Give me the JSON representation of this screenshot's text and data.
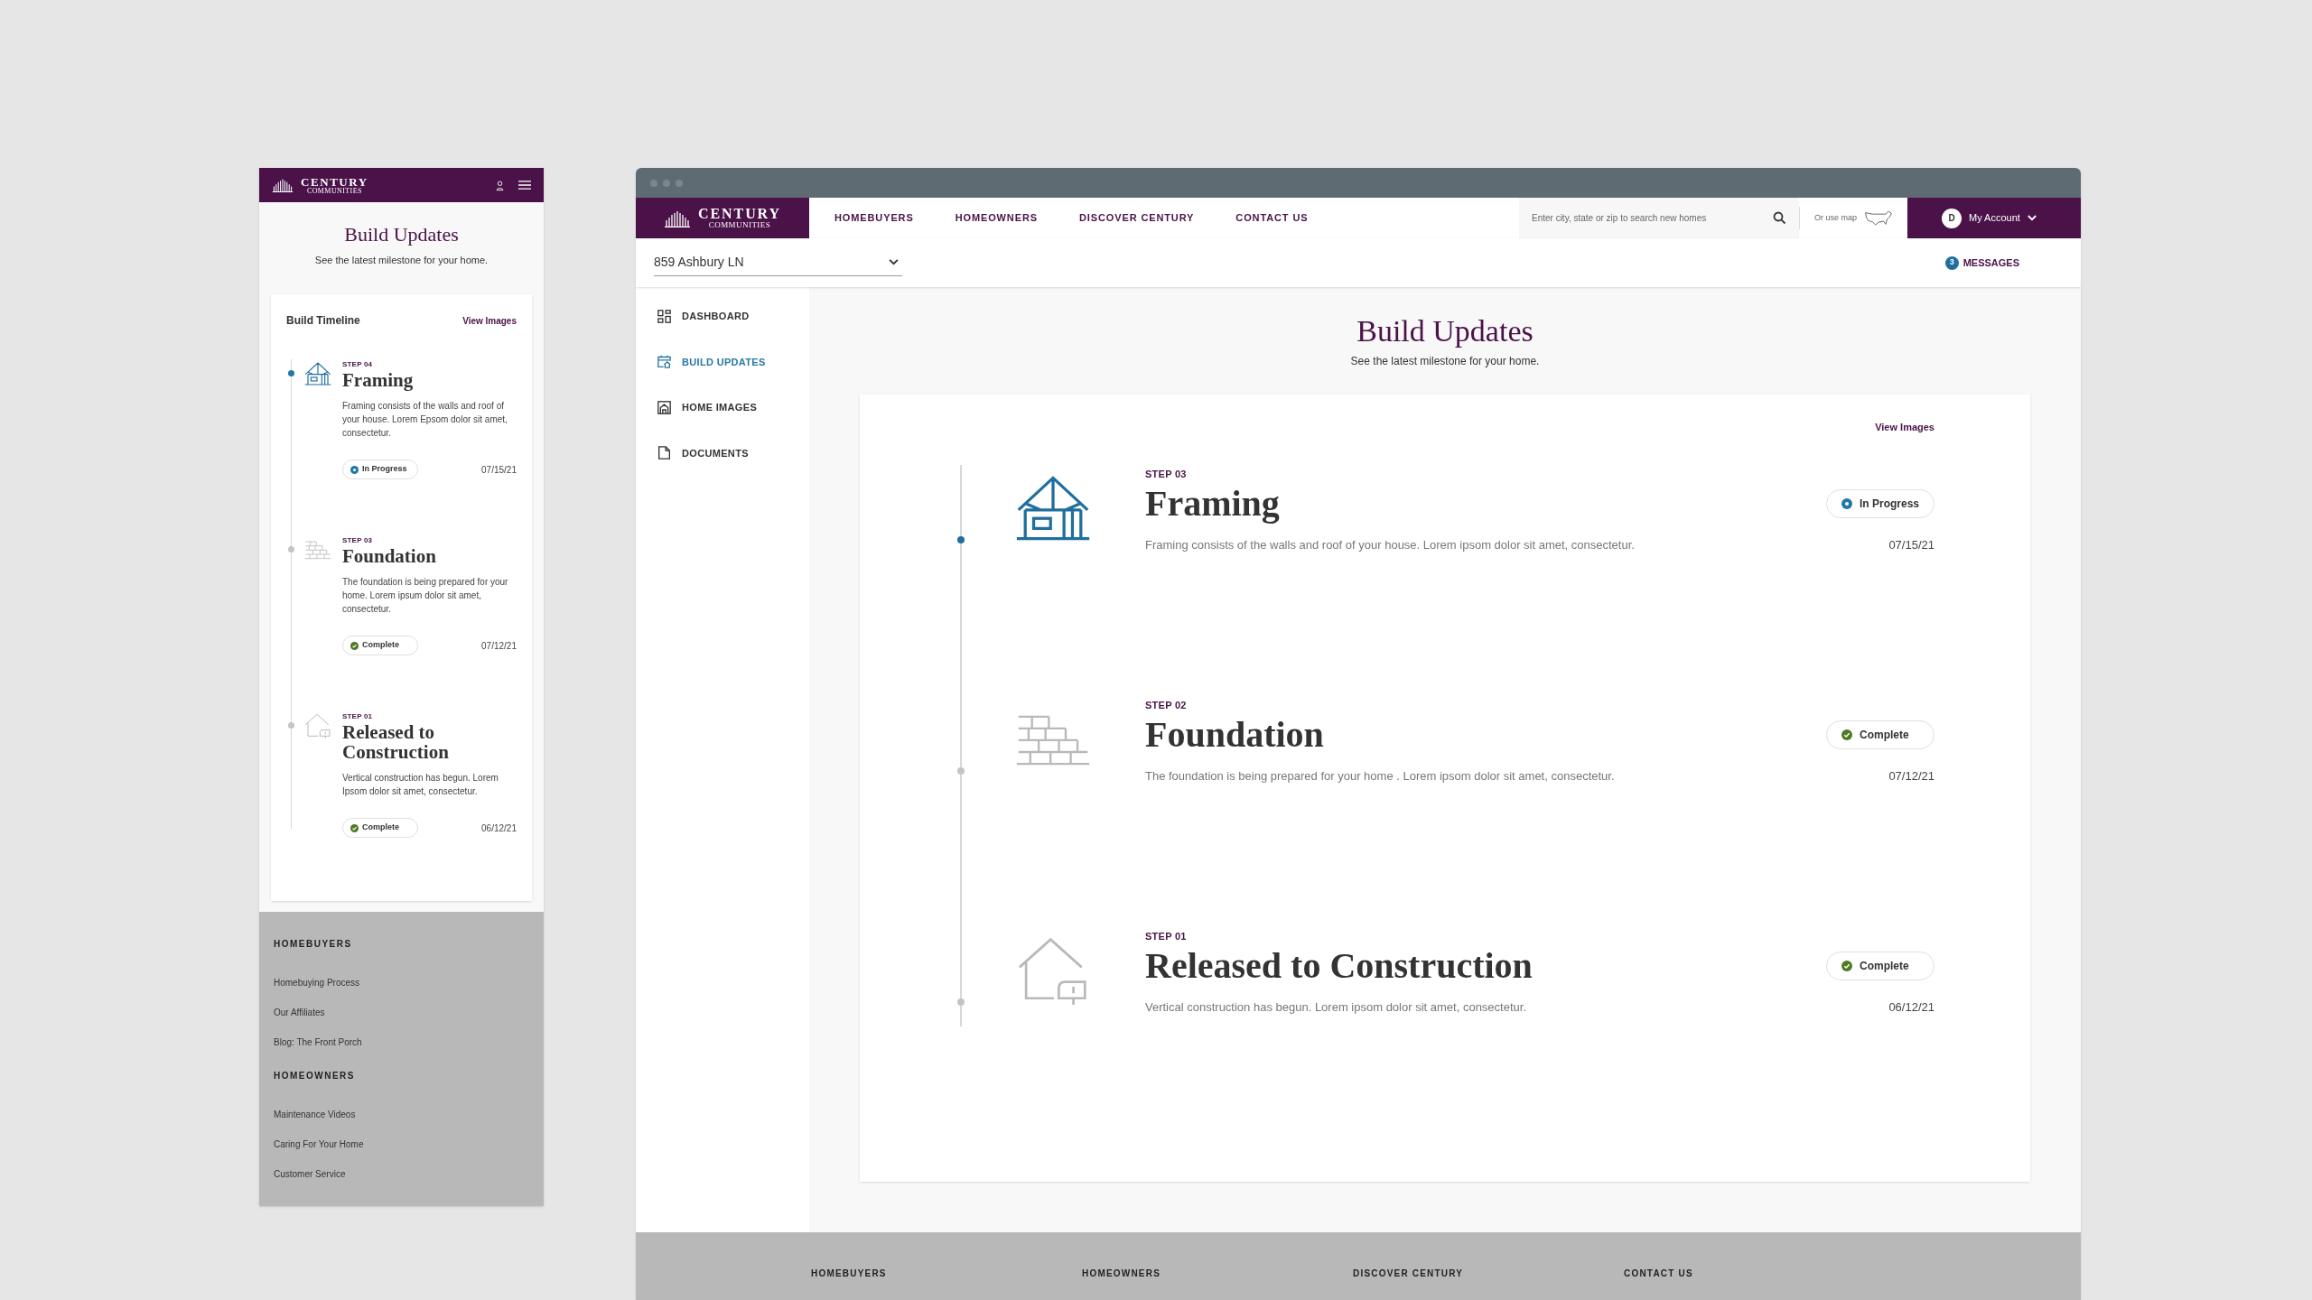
{
  "mobile": {
    "header": {
      "brand": "CENTURY",
      "brand_sub": "COMMUNITIES"
    },
    "title": "Build Updates",
    "subtitle": "See the latest milestone for your home.",
    "card": {
      "heading": "Build Timeline",
      "link": "View Images",
      "steps": [
        {
          "kind": "framing",
          "step": "STEP 04",
          "title": "Framing",
          "description": "Framing consists of the walls and roof of your house. Lorem Epsom dolor sit amet, consectetur.",
          "status": {
            "kind": "in_progress",
            "label": "In Progress"
          },
          "date": "07/15/21",
          "current": true
        },
        {
          "kind": "foundation",
          "step": "STEP 03",
          "title": "Foundation",
          "description": "The foundation is being prepared for your home. Lorem ipsum dolor sit amet, consectetur.",
          "status": {
            "kind": "complete",
            "label": "Complete"
          },
          "date": "07/12/21",
          "current": false
        },
        {
          "kind": "released",
          "step": "STEP 01",
          "title": "Released to Construction",
          "description": "Vertical construction has begun. Lorem Ipsom dolor sit amet, consectetur.",
          "status": {
            "kind": "complete",
            "label": "Complete"
          },
          "date": "06/12/21",
          "current": false
        }
      ]
    },
    "footer": [
      {
        "heading": "HOMEBUYERS",
        "links": [
          "Homebuying Process",
          "Our Affiliates",
          "Blog: The Front Porch"
        ]
      },
      {
        "heading": "HOMEOWNERS",
        "links": [
          "Maintenance Videos",
          "Caring For Your Home",
          "Customer Service"
        ]
      }
    ]
  },
  "desktop": {
    "header": {
      "brand": "CENTURY",
      "brand_sub": "COMMUNITIES"
    },
    "nav": [
      "HOMEBUYERS",
      "HOMEOWNERS",
      "DISCOVER CENTURY",
      "CONTACT US"
    ],
    "search": {
      "placeholder": "Enter city, state or zip to search new homes"
    },
    "map_link": "Or use map",
    "account": {
      "initial": "D",
      "label": "My Account"
    },
    "address": {
      "value": "859 Ashbury LN"
    },
    "messages": {
      "count": "3",
      "label": "MESSAGES"
    },
    "sidebar": [
      {
        "label": "DASHBOARD",
        "selected": false
      },
      {
        "label": "BUILD UPDATES",
        "selected": true
      },
      {
        "label": "HOME IMAGES",
        "selected": false
      },
      {
        "label": "DOCUMENTS",
        "selected": false
      }
    ],
    "title": "Build Updates",
    "subtitle": "See the latest milestone for your home.",
    "card": {
      "link": "View Images",
      "steps": [
        {
          "kind": "framing",
          "step": "STEP 03",
          "title": "Framing",
          "description": "Framing consists of the walls and roof of your house. Lorem ipsom dolor sit amet, consectetur.",
          "status": {
            "kind": "in_progress",
            "label": "In Progress"
          },
          "date": "07/15/21",
          "current": true
        },
        {
          "kind": "foundation",
          "step": "STEP 02",
          "title": "Foundation",
          "description": "The foundation is being prepared for your home . Lorem ipsom dolor sit amet, consectetur.",
          "status": {
            "kind": "complete",
            "label": "Complete"
          },
          "date": "07/12/21",
          "current": false
        },
        {
          "kind": "released",
          "step": "STEP 01",
          "title": "Released to Construction",
          "description": "Vertical construction has begun. Lorem ipsom dolor sit amet, consectetur.",
          "status": {
            "kind": "complete",
            "label": "Complete"
          },
          "date": "06/12/21",
          "current": false
        }
      ]
    },
    "footer": [
      "HOMEBUYERS",
      "HOMEOWNERS",
      "DISCOVER CENTURY",
      "CONTACT US"
    ]
  }
}
